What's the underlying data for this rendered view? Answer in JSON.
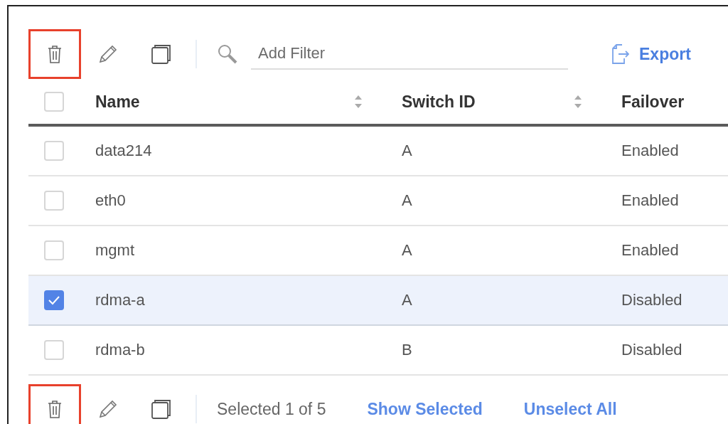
{
  "toolbar": {
    "tools": [
      {
        "kind": "delete",
        "highlighted": true
      },
      {
        "kind": "edit",
        "highlighted": false
      },
      {
        "kind": "copy",
        "highlighted": false
      }
    ],
    "filter": {
      "placeholder": "Add Filter"
    },
    "export": "Export"
  },
  "table": {
    "select_all_checked": false,
    "columns": [
      {
        "label": "Name",
        "sortable": true
      },
      {
        "label": "Switch ID",
        "sortable": true
      },
      {
        "label": "Failover",
        "sortable": false
      }
    ],
    "rows": [
      {
        "selected": false,
        "cells": [
          "data214",
          "A",
          "Enabled"
        ]
      },
      {
        "selected": false,
        "cells": [
          "eth0",
          "A",
          "Enabled"
        ]
      },
      {
        "selected": false,
        "cells": [
          "mgmt",
          "A",
          "Enabled"
        ]
      },
      {
        "selected": true,
        "cells": [
          "rdma-a",
          "A",
          "Disabled"
        ]
      },
      {
        "selected": false,
        "cells": [
          "rdma-b",
          "B",
          "Disabled"
        ]
      }
    ]
  },
  "footer": {
    "tools": [
      {
        "kind": "delete",
        "highlighted": true
      },
      {
        "kind": "edit",
        "highlighted": false
      },
      {
        "kind": "copy",
        "highlighted": false
      }
    ],
    "selection_count": "Selected 1 of 5",
    "links": [
      "Show Selected",
      "Unselect All"
    ]
  }
}
